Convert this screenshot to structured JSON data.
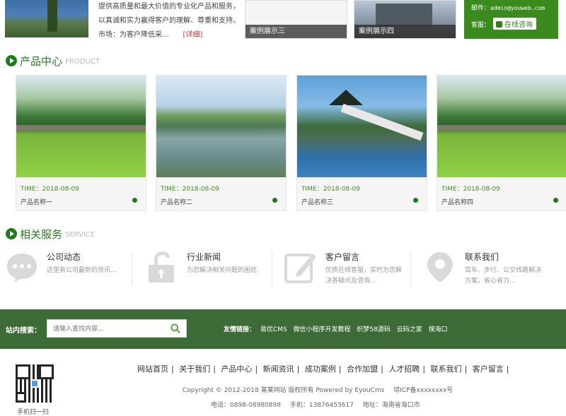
{
  "top": {
    "about_lines": [
      "提供高质量和最大价值的专业化产品和服务，",
      "以真诚和实力赢得客户的理解、尊重和支持。",
      "市场：为客户降低采..."
    ],
    "about_more": "[详细]",
    "case3_caption": "案例展示三",
    "case4_caption": "案例展示四",
    "contact_email_label": "邮件：",
    "contact_email": "admin@youweb.com",
    "contact_service_label": "客服：",
    "contact_button": "在线咨询"
  },
  "products": {
    "title": "产品中心",
    "title_en": "PRODUCT",
    "items": [
      {
        "time": "TIME：2018-08-09",
        "name": "产品名称一"
      },
      {
        "time": "TIME：2018-08-09",
        "name": "产品名称二"
      },
      {
        "time": "TIME：2018-08-09",
        "name": "产品名称三"
      },
      {
        "time": "TIME：2018-08-09",
        "name": "产品名称四"
      }
    ]
  },
  "services": {
    "title": "相关服务",
    "title_en": "SERVICE",
    "items": [
      {
        "title": "公司动态",
        "desc": "这里有公司最新的资讯..."
      },
      {
        "title": "行业新闻",
        "desc": "为您解决相关问题的困扰"
      },
      {
        "title": "客户留言",
        "desc": "优质在线客服，实时为您解决各疑问及咨询..."
      },
      {
        "title": "联系我们",
        "desc": "驾车、步行、公交线路解决方案，省心省力..."
      }
    ]
  },
  "search": {
    "label": "站内搜索：",
    "placeholder": "请输入查找内容...",
    "links_label": "友情链接：",
    "links": [
      "易优CMS",
      "微信小程序开发教程",
      "织梦58源码",
      "云码之家",
      "搜海口"
    ]
  },
  "footer": {
    "nav": [
      "网站首页",
      "关于我们",
      "产品中心",
      "新闻资讯",
      "成功案例",
      "合作加盟",
      "人才招聘",
      "联系我们",
      "客户留言"
    ],
    "copyright": "Copyright © 2012-2018 某某网站 版权所有 Powered by EyouCms",
    "icp": "琼ICP备xxxxxxxx号",
    "tel": "电话：0898-08980898",
    "mobile": "手机：13876453617",
    "address": "地址：海南省海口市",
    "qr_caption": "手机扫一扫"
  },
  "colors": {
    "accent_green": "#3c6b37",
    "title_green": "#2a7a24"
  }
}
